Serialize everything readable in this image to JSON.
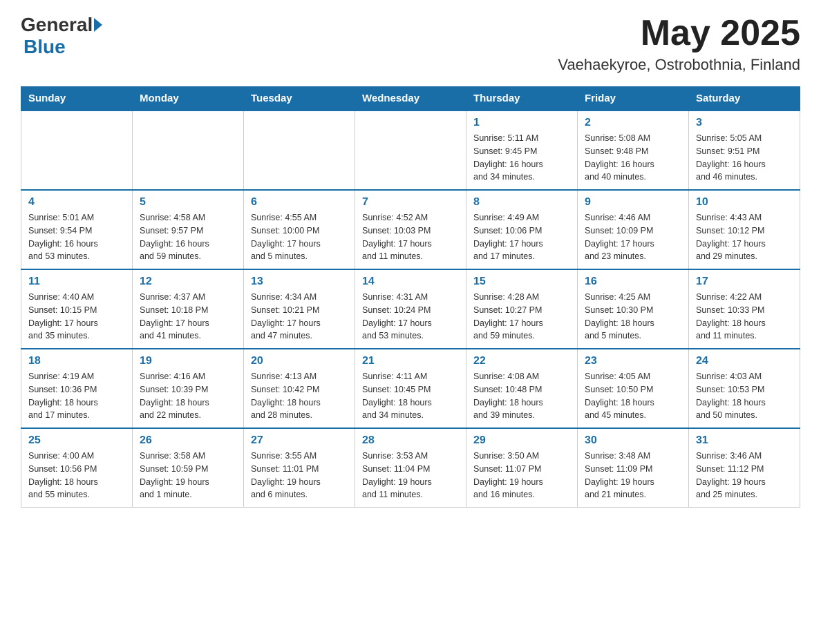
{
  "header": {
    "logo": {
      "text1": "General",
      "text2": "Blue"
    },
    "title": "May 2025",
    "location": "Vaehaekyroe, Ostrobothnia, Finland"
  },
  "weekdays": [
    "Sunday",
    "Monday",
    "Tuesday",
    "Wednesday",
    "Thursday",
    "Friday",
    "Saturday"
  ],
  "weeks": [
    [
      {
        "day": "",
        "info": ""
      },
      {
        "day": "",
        "info": ""
      },
      {
        "day": "",
        "info": ""
      },
      {
        "day": "",
        "info": ""
      },
      {
        "day": "1",
        "info": "Sunrise: 5:11 AM\nSunset: 9:45 PM\nDaylight: 16 hours\nand 34 minutes."
      },
      {
        "day": "2",
        "info": "Sunrise: 5:08 AM\nSunset: 9:48 PM\nDaylight: 16 hours\nand 40 minutes."
      },
      {
        "day": "3",
        "info": "Sunrise: 5:05 AM\nSunset: 9:51 PM\nDaylight: 16 hours\nand 46 minutes."
      }
    ],
    [
      {
        "day": "4",
        "info": "Sunrise: 5:01 AM\nSunset: 9:54 PM\nDaylight: 16 hours\nand 53 minutes."
      },
      {
        "day": "5",
        "info": "Sunrise: 4:58 AM\nSunset: 9:57 PM\nDaylight: 16 hours\nand 59 minutes."
      },
      {
        "day": "6",
        "info": "Sunrise: 4:55 AM\nSunset: 10:00 PM\nDaylight: 17 hours\nand 5 minutes."
      },
      {
        "day": "7",
        "info": "Sunrise: 4:52 AM\nSunset: 10:03 PM\nDaylight: 17 hours\nand 11 minutes."
      },
      {
        "day": "8",
        "info": "Sunrise: 4:49 AM\nSunset: 10:06 PM\nDaylight: 17 hours\nand 17 minutes."
      },
      {
        "day": "9",
        "info": "Sunrise: 4:46 AM\nSunset: 10:09 PM\nDaylight: 17 hours\nand 23 minutes."
      },
      {
        "day": "10",
        "info": "Sunrise: 4:43 AM\nSunset: 10:12 PM\nDaylight: 17 hours\nand 29 minutes."
      }
    ],
    [
      {
        "day": "11",
        "info": "Sunrise: 4:40 AM\nSunset: 10:15 PM\nDaylight: 17 hours\nand 35 minutes."
      },
      {
        "day": "12",
        "info": "Sunrise: 4:37 AM\nSunset: 10:18 PM\nDaylight: 17 hours\nand 41 minutes."
      },
      {
        "day": "13",
        "info": "Sunrise: 4:34 AM\nSunset: 10:21 PM\nDaylight: 17 hours\nand 47 minutes."
      },
      {
        "day": "14",
        "info": "Sunrise: 4:31 AM\nSunset: 10:24 PM\nDaylight: 17 hours\nand 53 minutes."
      },
      {
        "day": "15",
        "info": "Sunrise: 4:28 AM\nSunset: 10:27 PM\nDaylight: 17 hours\nand 59 minutes."
      },
      {
        "day": "16",
        "info": "Sunrise: 4:25 AM\nSunset: 10:30 PM\nDaylight: 18 hours\nand 5 minutes."
      },
      {
        "day": "17",
        "info": "Sunrise: 4:22 AM\nSunset: 10:33 PM\nDaylight: 18 hours\nand 11 minutes."
      }
    ],
    [
      {
        "day": "18",
        "info": "Sunrise: 4:19 AM\nSunset: 10:36 PM\nDaylight: 18 hours\nand 17 minutes."
      },
      {
        "day": "19",
        "info": "Sunrise: 4:16 AM\nSunset: 10:39 PM\nDaylight: 18 hours\nand 22 minutes."
      },
      {
        "day": "20",
        "info": "Sunrise: 4:13 AM\nSunset: 10:42 PM\nDaylight: 18 hours\nand 28 minutes."
      },
      {
        "day": "21",
        "info": "Sunrise: 4:11 AM\nSunset: 10:45 PM\nDaylight: 18 hours\nand 34 minutes."
      },
      {
        "day": "22",
        "info": "Sunrise: 4:08 AM\nSunset: 10:48 PM\nDaylight: 18 hours\nand 39 minutes."
      },
      {
        "day": "23",
        "info": "Sunrise: 4:05 AM\nSunset: 10:50 PM\nDaylight: 18 hours\nand 45 minutes."
      },
      {
        "day": "24",
        "info": "Sunrise: 4:03 AM\nSunset: 10:53 PM\nDaylight: 18 hours\nand 50 minutes."
      }
    ],
    [
      {
        "day": "25",
        "info": "Sunrise: 4:00 AM\nSunset: 10:56 PM\nDaylight: 18 hours\nand 55 minutes."
      },
      {
        "day": "26",
        "info": "Sunrise: 3:58 AM\nSunset: 10:59 PM\nDaylight: 19 hours\nand 1 minute."
      },
      {
        "day": "27",
        "info": "Sunrise: 3:55 AM\nSunset: 11:01 PM\nDaylight: 19 hours\nand 6 minutes."
      },
      {
        "day": "28",
        "info": "Sunrise: 3:53 AM\nSunset: 11:04 PM\nDaylight: 19 hours\nand 11 minutes."
      },
      {
        "day": "29",
        "info": "Sunrise: 3:50 AM\nSunset: 11:07 PM\nDaylight: 19 hours\nand 16 minutes."
      },
      {
        "day": "30",
        "info": "Sunrise: 3:48 AM\nSunset: 11:09 PM\nDaylight: 19 hours\nand 21 minutes."
      },
      {
        "day": "31",
        "info": "Sunrise: 3:46 AM\nSunset: 11:12 PM\nDaylight: 19 hours\nand 25 minutes."
      }
    ]
  ]
}
